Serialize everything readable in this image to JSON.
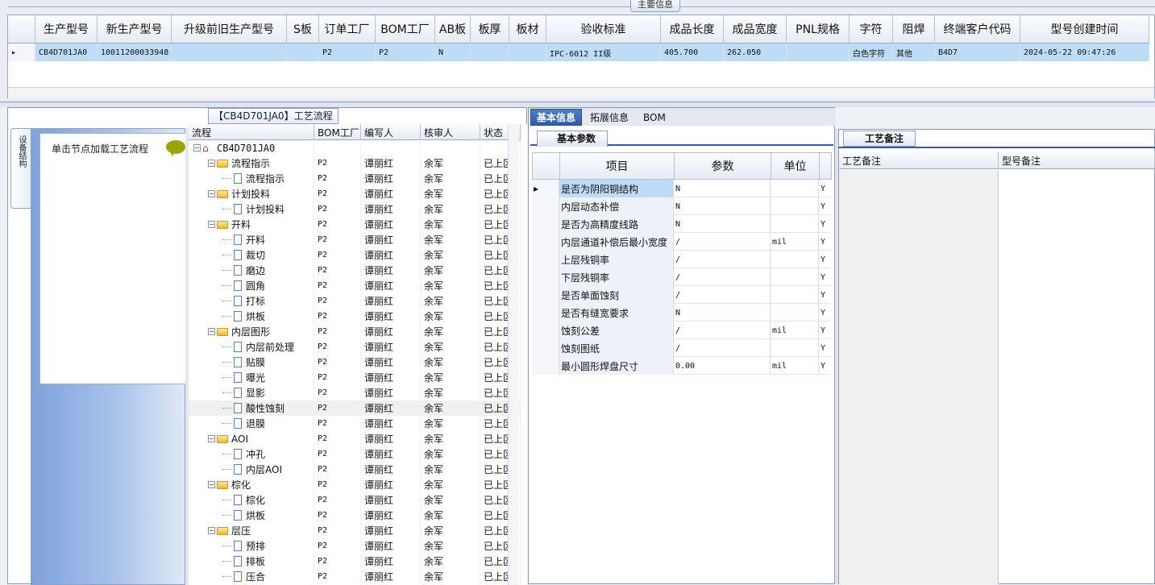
{
  "top": {
    "title": "主要信息",
    "columns": [
      "生产型号",
      "新生产型号",
      "升级前旧生产型号",
      "S板",
      "订单工厂",
      "BOM工厂",
      "AB板",
      "板厚",
      "板材",
      "验收标准",
      "成品长度",
      "成品宽度",
      "PNL规格",
      "字符",
      "阻焊",
      "终端客户代码",
      "型号创建时间"
    ],
    "row": [
      "CB4D701JA0",
      "10011200033948",
      "",
      "",
      "P2",
      "P2",
      "N",
      "",
      "",
      "IPC-6012 II级",
      "405.700",
      "262.050",
      "",
      "白色字符",
      "其他",
      "B4D7",
      "2024-05-22 09:47:26"
    ]
  },
  "left": {
    "panel_title": "【CB4D701JA0】工艺流程",
    "vertical_tab": "设备结构",
    "node_hint": "单击节点加载工艺流程",
    "tree_columns": [
      "流程",
      "BOM工厂",
      "编写人",
      "核审人",
      "状态"
    ],
    "tree": [
      {
        "label": "CB4D701JA0",
        "level": 0,
        "kind": "root",
        "bom": "",
        "writer": "",
        "checker": "",
        "status": ""
      },
      {
        "label": "流程指示",
        "level": 1,
        "kind": "folder",
        "bom": "P2",
        "writer": "谭丽红",
        "checker": "余军",
        "status": "已上区"
      },
      {
        "label": "流程指示",
        "level": 2,
        "kind": "doc",
        "bom": "P2",
        "writer": "谭丽红",
        "checker": "余军",
        "status": "已上区"
      },
      {
        "label": "计划投料",
        "level": 1,
        "kind": "folder",
        "bom": "P2",
        "writer": "谭丽红",
        "checker": "余军",
        "status": "已上区"
      },
      {
        "label": "计划投料",
        "level": 2,
        "kind": "doc",
        "bom": "P2",
        "writer": "谭丽红",
        "checker": "余军",
        "status": "已上区"
      },
      {
        "label": "开料",
        "level": 1,
        "kind": "folder",
        "bom": "P2",
        "writer": "谭丽红",
        "checker": "余军",
        "status": "已上区"
      },
      {
        "label": "开料",
        "level": 2,
        "kind": "doc",
        "bom": "P2",
        "writer": "谭丽红",
        "checker": "余军",
        "status": "已上区"
      },
      {
        "label": "裁切",
        "level": 2,
        "kind": "doc",
        "bom": "P2",
        "writer": "谭丽红",
        "checker": "余军",
        "status": "已上区"
      },
      {
        "label": "磨边",
        "level": 2,
        "kind": "doc",
        "bom": "P2",
        "writer": "谭丽红",
        "checker": "余军",
        "status": "已上区"
      },
      {
        "label": "圆角",
        "level": 2,
        "kind": "doc",
        "bom": "P2",
        "writer": "谭丽红",
        "checker": "余军",
        "status": "已上区"
      },
      {
        "label": "打标",
        "level": 2,
        "kind": "doc",
        "bom": "P2",
        "writer": "谭丽红",
        "checker": "余军",
        "status": "已上区"
      },
      {
        "label": "烘板",
        "level": 2,
        "kind": "doc",
        "bom": "P2",
        "writer": "谭丽红",
        "checker": "余军",
        "status": "已上区"
      },
      {
        "label": "内层图形",
        "level": 1,
        "kind": "folder",
        "bom": "P2",
        "writer": "谭丽红",
        "checker": "余军",
        "status": "已上区"
      },
      {
        "label": "内层前处理",
        "level": 2,
        "kind": "doc",
        "bom": "P2",
        "writer": "谭丽红",
        "checker": "余军",
        "status": "已上区"
      },
      {
        "label": "贴膜",
        "level": 2,
        "kind": "doc",
        "bom": "P2",
        "writer": "谭丽红",
        "checker": "余军",
        "status": "已上区"
      },
      {
        "label": "曝光",
        "level": 2,
        "kind": "doc",
        "bom": "P2",
        "writer": "谭丽红",
        "checker": "余军",
        "status": "已上区"
      },
      {
        "label": "显影",
        "level": 2,
        "kind": "doc",
        "bom": "P2",
        "writer": "谭丽红",
        "checker": "余军",
        "status": "已上区"
      },
      {
        "label": "酸性蚀刻",
        "level": 2,
        "kind": "doc",
        "bom": "P2",
        "writer": "谭丽红",
        "checker": "余军",
        "status": "已上区",
        "selected": true
      },
      {
        "label": "退膜",
        "level": 2,
        "kind": "doc",
        "bom": "P2",
        "writer": "谭丽红",
        "checker": "余军",
        "status": "已上区"
      },
      {
        "label": "AOI",
        "level": 1,
        "kind": "folder",
        "bom": "P2",
        "writer": "谭丽红",
        "checker": "余军",
        "status": "已上区"
      },
      {
        "label": "冲孔",
        "level": 2,
        "kind": "doc",
        "bom": "P2",
        "writer": "谭丽红",
        "checker": "余军",
        "status": "已上区"
      },
      {
        "label": "内层AOI",
        "level": 2,
        "kind": "doc",
        "bom": "P2",
        "writer": "谭丽红",
        "checker": "余军",
        "status": "已上区"
      },
      {
        "label": "棕化",
        "level": 1,
        "kind": "folder",
        "bom": "P2",
        "writer": "谭丽红",
        "checker": "余军",
        "status": "已上区"
      },
      {
        "label": "棕化",
        "level": 2,
        "kind": "doc",
        "bom": "P2",
        "writer": "谭丽红",
        "checker": "余军",
        "status": "已上区"
      },
      {
        "label": "烘板",
        "level": 2,
        "kind": "doc",
        "bom": "P2",
        "writer": "谭丽红",
        "checker": "余军",
        "status": "已上区"
      },
      {
        "label": "层压",
        "level": 1,
        "kind": "folder",
        "bom": "P2",
        "writer": "谭丽红",
        "checker": "余军",
        "status": "已上区"
      },
      {
        "label": "预排",
        "level": 2,
        "kind": "doc",
        "bom": "P2",
        "writer": "谭丽红",
        "checker": "余军",
        "status": "已上区"
      },
      {
        "label": "排板",
        "level": 2,
        "kind": "doc",
        "bom": "P2",
        "writer": "谭丽红",
        "checker": "余军",
        "status": "已上区"
      },
      {
        "label": "压合",
        "level": 2,
        "kind": "doc",
        "bom": "P2",
        "writer": "谭丽红",
        "checker": "余军",
        "status": "已上区"
      }
    ]
  },
  "mid": {
    "tabs": [
      "基本信息",
      "拓展信息",
      "BOM"
    ],
    "section_title": "基本参数",
    "columns": [
      "项目",
      "参数",
      "单位"
    ],
    "rows": [
      {
        "name": "是否为阴阳铜结构",
        "value": "N",
        "unit": "",
        "flag": "Y"
      },
      {
        "name": "内层动态补偿",
        "value": "N",
        "unit": "",
        "flag": "Y"
      },
      {
        "name": "是否为高精度线路",
        "value": "N",
        "unit": "",
        "flag": "Y"
      },
      {
        "name": "内层通道补偿后最小宽度",
        "value": "/",
        "unit": "mil",
        "flag": "Y"
      },
      {
        "name": "上层残铜率",
        "value": "/",
        "unit": "",
        "flag": "Y"
      },
      {
        "name": "下层残铜率",
        "value": "/",
        "unit": "",
        "flag": "Y"
      },
      {
        "name": "是否单面蚀刻",
        "value": "/",
        "unit": "",
        "flag": "Y"
      },
      {
        "name": "是否有缝宽要求",
        "value": "N",
        "unit": "",
        "flag": "Y"
      },
      {
        "name": "蚀刻公差",
        "value": "/",
        "unit": "mil",
        "flag": "Y"
      },
      {
        "name": "蚀刻图纸",
        "value": "/",
        "unit": "",
        "flag": "Y"
      },
      {
        "name": "最小圆形焊盘尺寸",
        "value": "0.00",
        "unit": "mil",
        "flag": "Y"
      }
    ]
  },
  "right": {
    "section_title": "工艺备注",
    "columns": [
      "工艺备注",
      "型号备注"
    ]
  }
}
